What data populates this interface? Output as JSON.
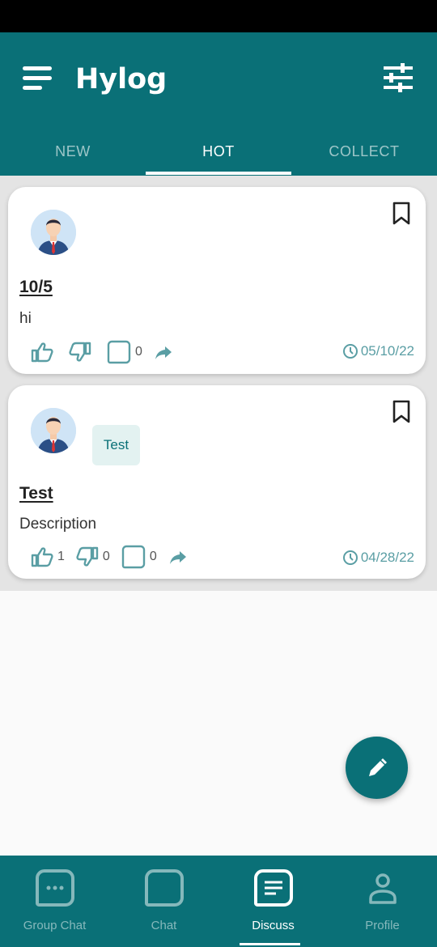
{
  "app": {
    "title": "Hylog"
  },
  "tabs": [
    {
      "label": "NEW",
      "active": false
    },
    {
      "label": "HOT",
      "active": true
    },
    {
      "label": "COLLECT",
      "active": false
    }
  ],
  "posts": [
    {
      "title": "10/5",
      "description": "hi",
      "tag": "",
      "likes": "",
      "dislikes": "",
      "comments": "0",
      "date": "05/10/22"
    },
    {
      "title": "Test",
      "description": "Description",
      "tag": "Test",
      "likes": "1",
      "dislikes": "0",
      "comments": "0",
      "date": "04/28/22"
    }
  ],
  "bottom_nav": [
    {
      "label": "Group Chat",
      "icon": "group-chat-icon",
      "active": false
    },
    {
      "label": "Chat",
      "icon": "chat-icon",
      "active": false
    },
    {
      "label": "Discuss",
      "icon": "discuss-icon",
      "active": true
    },
    {
      "label": "Profile",
      "icon": "profile-icon",
      "active": false
    }
  ],
  "colors": {
    "primary": "#0a7077",
    "accent_text": "#5a9ea4",
    "tag_bg": "#e3f2f1"
  }
}
